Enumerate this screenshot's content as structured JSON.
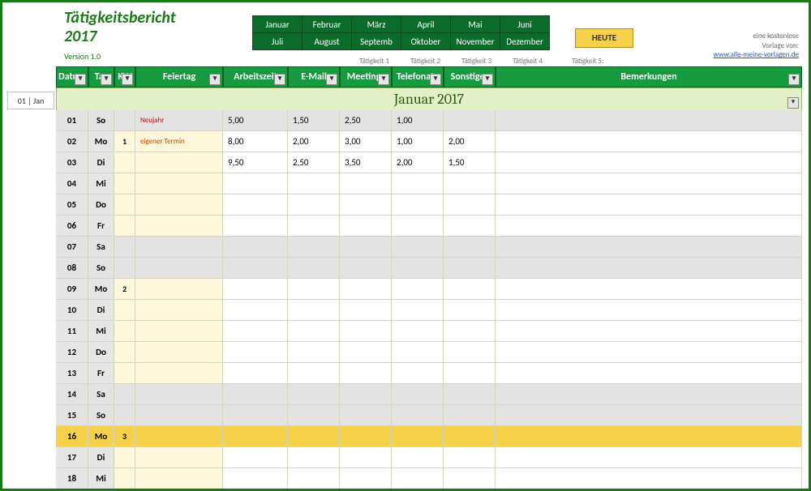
{
  "title": "Tätigkeitsbericht",
  "year": "2017",
  "version": "Version 1.0",
  "monthsRow1": [
    "Januar",
    "Februar",
    "März",
    "April",
    "Mai",
    "Juni"
  ],
  "monthsRow2": [
    "Juli",
    "August",
    "Septemb",
    "Oktober",
    "November",
    "Dezember"
  ],
  "heute": "HEUTE",
  "attrib1": "eine kostenlose",
  "attrib2": "Vorlage von:",
  "attribLink": "www.alle-meine-vorlagen.de",
  "tlabels": [
    "Tätigkeit 1",
    "Tätigkeit 2",
    "Tätigkeit 3",
    "Tätigkeit 4",
    "Tätigkeit 5:"
  ],
  "headers": {
    "datum": "Datum",
    "tag": "Tag",
    "kw": "KW",
    "feiertag": "Feiertag",
    "arbeitszeit": "Arbeitszeit",
    "email": "E-Mail",
    "meetings": "Meetings",
    "telefonate": "Telefonate",
    "sonstiges": "Sonstiges",
    "bemerkungen": "Bemerkungen"
  },
  "monthTitle": "Januar 2017",
  "sideTab": "01 | Jan",
  "rows": [
    {
      "d": "01",
      "t": "So",
      "kw": "",
      "ft": "Neujahr",
      "ftc": "holiday",
      "v": [
        "5,00",
        "1,50",
        "2,50",
        "1,00",
        ""
      ],
      "b": "",
      "kind": "weekend"
    },
    {
      "d": "02",
      "t": "Mo",
      "kw": "1",
      "ft": "eigener Termin",
      "ftc": "own",
      "v": [
        "8,00",
        "2,00",
        "3,00",
        "1,00",
        "2,00"
      ],
      "b": "",
      "kind": ""
    },
    {
      "d": "03",
      "t": "Di",
      "kw": "",
      "ft": "",
      "ftc": "",
      "v": [
        "9,50",
        "2,50",
        "3,50",
        "2,00",
        "1,50"
      ],
      "b": "",
      "kind": ""
    },
    {
      "d": "04",
      "t": "Mi",
      "kw": "",
      "ft": "",
      "ftc": "",
      "v": [
        "",
        "",
        "",
        "",
        ""
      ],
      "b": "",
      "kind": ""
    },
    {
      "d": "05",
      "t": "Do",
      "kw": "",
      "ft": "",
      "ftc": "",
      "v": [
        "",
        "",
        "",
        "",
        ""
      ],
      "b": "",
      "kind": ""
    },
    {
      "d": "06",
      "t": "Fr",
      "kw": "",
      "ft": "",
      "ftc": "",
      "v": [
        "",
        "",
        "",
        "",
        ""
      ],
      "b": "",
      "kind": ""
    },
    {
      "d": "07",
      "t": "Sa",
      "kw": "",
      "ft": "",
      "ftc": "",
      "v": [
        "",
        "",
        "",
        "",
        ""
      ],
      "b": "",
      "kind": "weekend"
    },
    {
      "d": "08",
      "t": "So",
      "kw": "",
      "ft": "",
      "ftc": "",
      "v": [
        "",
        "",
        "",
        "",
        ""
      ],
      "b": "",
      "kind": "weekend"
    },
    {
      "d": "09",
      "t": "Mo",
      "kw": "2",
      "ft": "",
      "ftc": "",
      "v": [
        "",
        "",
        "",
        "",
        ""
      ],
      "b": "",
      "kind": ""
    },
    {
      "d": "10",
      "t": "Di",
      "kw": "",
      "ft": "",
      "ftc": "",
      "v": [
        "",
        "",
        "",
        "",
        ""
      ],
      "b": "",
      "kind": ""
    },
    {
      "d": "11",
      "t": "Mi",
      "kw": "",
      "ft": "",
      "ftc": "",
      "v": [
        "",
        "",
        "",
        "",
        ""
      ],
      "b": "",
      "kind": ""
    },
    {
      "d": "12",
      "t": "Do",
      "kw": "",
      "ft": "",
      "ftc": "",
      "v": [
        "",
        "",
        "",
        "",
        ""
      ],
      "b": "",
      "kind": ""
    },
    {
      "d": "13",
      "t": "Fr",
      "kw": "",
      "ft": "",
      "ftc": "",
      "v": [
        "",
        "",
        "",
        "",
        ""
      ],
      "b": "",
      "kind": ""
    },
    {
      "d": "14",
      "t": "Sa",
      "kw": "",
      "ft": "",
      "ftc": "",
      "v": [
        "",
        "",
        "",
        "",
        ""
      ],
      "b": "",
      "kind": "weekend"
    },
    {
      "d": "15",
      "t": "So",
      "kw": "",
      "ft": "",
      "ftc": "",
      "v": [
        "",
        "",
        "",
        "",
        ""
      ],
      "b": "",
      "kind": "weekend"
    },
    {
      "d": "16",
      "t": "Mo",
      "kw": "3",
      "ft": "",
      "ftc": "",
      "v": [
        "",
        "",
        "",
        "",
        ""
      ],
      "b": "",
      "kind": "today"
    },
    {
      "d": "17",
      "t": "Di",
      "kw": "",
      "ft": "",
      "ftc": "",
      "v": [
        "",
        "",
        "",
        "",
        ""
      ],
      "b": "",
      "kind": ""
    },
    {
      "d": "18",
      "t": "Mi",
      "kw": "",
      "ft": "",
      "ftc": "",
      "v": [
        "",
        "",
        "",
        "",
        ""
      ],
      "b": "",
      "kind": ""
    }
  ]
}
